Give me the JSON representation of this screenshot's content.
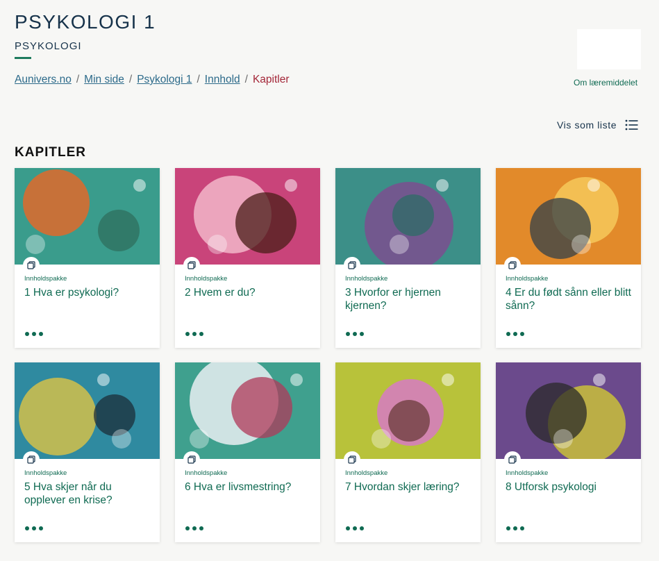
{
  "header": {
    "title": "PSYKOLOGI 1",
    "subtitle": "PSYKOLOGI",
    "about_link": "Om læremiddelet"
  },
  "breadcrumb": {
    "items": [
      "Aunivers.no",
      "Min side",
      "Psykologi 1",
      "Innhold"
    ],
    "current": "Kapitler",
    "separator": "/"
  },
  "view_toggle": {
    "label": "Vis som liste",
    "icon": "list-icon"
  },
  "section": {
    "title": "KAPITLER"
  },
  "cards": [
    {
      "type": "Innholdspakke",
      "title": "1 Hva er psykologi?",
      "icon": "copy-icon",
      "colors": [
        "#3a9c8c",
        "#e06a2a",
        "#2f6f5d"
      ]
    },
    {
      "type": "Innholdspakke",
      "title": "2 Hvem er du?",
      "icon": "copy-icon",
      "colors": [
        "#c9447a",
        "#f2b6c9",
        "#4a1e18"
      ]
    },
    {
      "type": "Innholdspakke",
      "title": "3 Hvorfor er hjernen kjernen?",
      "icon": "copy-icon",
      "colors": [
        "#3c8f88",
        "#7b4f8f",
        "#2e6c66"
      ]
    },
    {
      "type": "Innholdspakke",
      "title": "4 Er du født sånn eller blitt sånn?",
      "icon": "copy-icon",
      "colors": [
        "#e28a2a",
        "#f6c85a",
        "#33404a"
      ]
    },
    {
      "type": "Innholdspakke",
      "title": "5 Hva skjer når du opplever en krise?",
      "icon": "copy-icon",
      "colors": [
        "#2f8aa0",
        "#d2c04a",
        "#1c2e3a"
      ]
    },
    {
      "type": "Innholdspakke",
      "title": "6 Hva er livsmestring?",
      "icon": "copy-icon",
      "colors": [
        "#3fa08e",
        "#e9eef2",
        "#b03a5a"
      ]
    },
    {
      "type": "Innholdspakke",
      "title": "7 Hvordan skjer læring?",
      "icon": "copy-icon",
      "colors": [
        "#b8c23a",
        "#d67ac4",
        "#6a3c3a"
      ]
    },
    {
      "type": "Innholdspakke",
      "title": "8 Utforsk psykologi",
      "icon": "copy-icon",
      "colors": [
        "#6b4a8c",
        "#c9c03a",
        "#2a2a2a"
      ]
    }
  ]
}
